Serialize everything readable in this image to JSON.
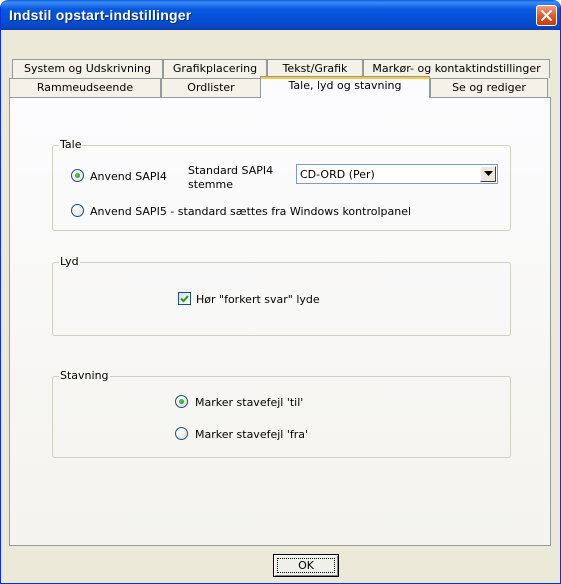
{
  "window": {
    "title": "Indstil opstart-indstillinger"
  },
  "tabs": {
    "row1": [
      {
        "label": "System og Udskrivning"
      },
      {
        "label": "Grafikplacering"
      },
      {
        "label": "Tekst/Grafik"
      },
      {
        "label": "Markør- og kontaktindstillinger"
      }
    ],
    "row2": [
      {
        "label": "Rammeudseende"
      },
      {
        "label": "Ordlister"
      },
      {
        "label": "Tale, lyd og stavning",
        "active": true
      },
      {
        "label": "Se og rediger"
      }
    ]
  },
  "tale": {
    "group_label": "Tale",
    "sapi4_label": "Anvend SAPI4",
    "standard_label_line1": "Standard SAPI4",
    "standard_label_line2": "stemme",
    "voice_value": "CD-ORD (Per)",
    "sapi5_label": "Anvend SAPI5 - standard sættes fra Windows kontrolpanel"
  },
  "lyd": {
    "group_label": "Lyd",
    "wrong_answer_label": "Hør \"forkert svar\" lyde"
  },
  "stavning": {
    "group_label": "Stavning",
    "on_label": "Marker stavefejl 'til'",
    "off_label": "Marker stavefejl 'fra'"
  },
  "buttons": {
    "ok_label": "OK"
  },
  "colors": {
    "titlebar": "#0858e0",
    "close_button": "#e05a2a",
    "dialog_bg": "#ece9d8",
    "active_tab_marker": "#ffc83c"
  }
}
